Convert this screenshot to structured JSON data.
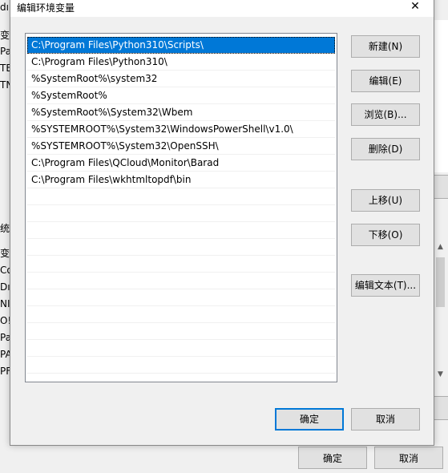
{
  "background_window": {
    "left_clip_letters": [
      "dı",
      "变",
      "Pa",
      "TE",
      "TN",
      "统",
      "变",
      "Co",
      "Dı",
      "NI",
      "O!",
      "Pa",
      "PA",
      "PF"
    ],
    "ok_label": "确定",
    "cancel_label": "取消"
  },
  "dialog": {
    "title": "编辑环境变量",
    "close_glyph": "✕",
    "path_entries": [
      "C:\\Program Files\\Python310\\Scripts\\",
      "C:\\Program Files\\Python310\\",
      "%SystemRoot%\\system32",
      "%SystemRoot%",
      "%SystemRoot%\\System32\\Wbem",
      "%SYSTEMROOT%\\System32\\WindowsPowerShell\\v1.0\\",
      "%SYSTEMROOT%\\System32\\OpenSSH\\",
      "C:\\Program Files\\QCloud\\Monitor\\Barad",
      "C:\\Program Files\\wkhtmltopdf\\bin"
    ],
    "selected_index": 0,
    "buttons": {
      "new": "新建(N)",
      "edit": "编辑(E)",
      "browse": "浏览(B)...",
      "delete": "删除(D)",
      "move_up": "上移(U)",
      "move_down": "下移(O)",
      "edit_text": "编辑文本(T)...",
      "ok": "确定",
      "cancel": "取消"
    }
  },
  "colors": {
    "selection": "#0078d7",
    "button_face": "#e1e1e1",
    "window_bg": "#f0f0f0"
  }
}
